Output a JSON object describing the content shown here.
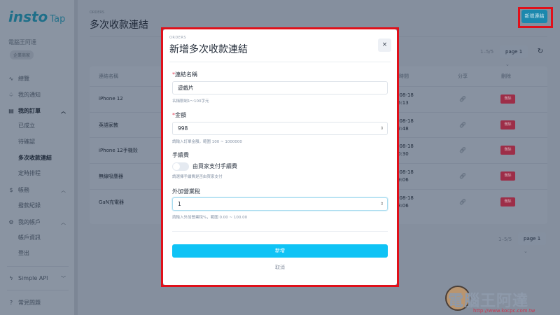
{
  "sidebar": {
    "logo": "insto",
    "logo_sub": "Tap",
    "user": "電腦王阿達",
    "badge": "企業商家",
    "items": [
      {
        "label": "總覽",
        "icon": "activity-icon"
      },
      {
        "label": "我的通知",
        "icon": "bell-icon"
      },
      {
        "label": "我的訂單",
        "icon": "document-icon"
      },
      {
        "label": "已成立"
      },
      {
        "label": "待確認"
      },
      {
        "label": "多次收款連結"
      },
      {
        "label": "定時排程"
      },
      {
        "label": "帳務",
        "icon": "dollar-icon"
      },
      {
        "label": "撥款紀錄"
      },
      {
        "label": "我的帳戶",
        "icon": "gear-icon"
      },
      {
        "label": "帳戶資訊"
      },
      {
        "label": "登出"
      },
      {
        "label": "Simple API",
        "icon": "bolt-icon"
      },
      {
        "label": "常見問題",
        "icon": "help-icon"
      }
    ]
  },
  "main": {
    "eyebrow": "ORDERS",
    "title": "多次收款連結",
    "add_button": "新增連結",
    "range": "1–5/5",
    "page": "page 1",
    "columns": {
      "name": "連結名稱",
      "time": "時間",
      "share": "分享",
      "delete": "刪除"
    },
    "rows": [
      {
        "name": "iPhone 12",
        "date": "-08-18",
        "time": "5:13",
        "delete": "刪除"
      },
      {
        "name": "英語家教",
        "date": "-08-18",
        "time": "2:48",
        "delete": "刪除"
      },
      {
        "name": "iPhone 12手機殼",
        "date": "-08-18",
        "time": "0:30",
        "delete": "刪除"
      },
      {
        "name": "無線吸塵器",
        "date": "-08-18",
        "time": "9:06",
        "delete": "刪除"
      },
      {
        "name": "GaN充電器",
        "date": "-08-18",
        "time": "3:06",
        "delete": "刪除"
      }
    ]
  },
  "modal": {
    "eyebrow": "ORDERS",
    "title": "新增多次收款連結",
    "close": "×",
    "name_label": "連結名稱",
    "name_value": "遊戲片",
    "name_hint": "名稱限制1～100字元",
    "amount_label": "金額",
    "amount_value": "998",
    "amount_hint": "請輸入訂單金額，範圍 100 ~ 1000000",
    "fee_label": "手續費",
    "fee_toggle_label": "由買家支付手續費",
    "fee_hint": "請選擇手續費是否由買家支付",
    "fee_on": false,
    "tax_label": "外加營業稅",
    "tax_value": "1",
    "tax_hint": "請輸入外加營業稅%，範圍 0.00 ~ 100.00",
    "submit": "新增",
    "cancel": "取消"
  },
  "watermark": {
    "text": "電腦王阿達",
    "url": "http://www.kocpc.com.tw"
  }
}
